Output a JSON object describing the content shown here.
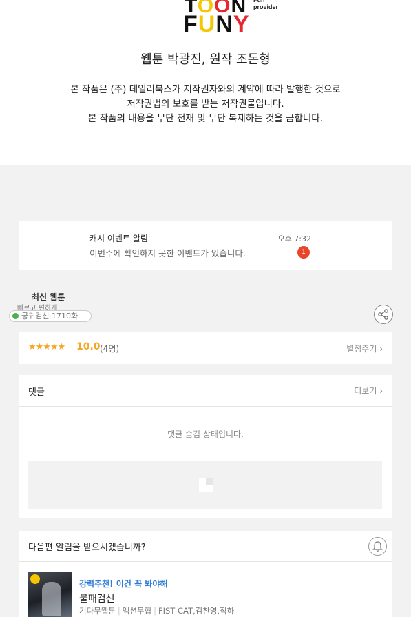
{
  "logo": {
    "line1_a": "T",
    "line1_b": "O",
    "line1_c": "O",
    "line1_d": "N",
    "tagline": "Fun provider",
    "line2_a": "F",
    "line2_b": "U",
    "line2_c": "N",
    "line2_d": "Y"
  },
  "credit": "웹툰 박광진, 원작 조돈형",
  "notice": [
    "본 작품은 (주) 데일리북스가 저작권자와의 계약에 따라 발행한 것으로",
    "저작권법의 보호를 받는 저작권물입니다.",
    "본 작품의 내용을 무단 전재 및 무단 복제하는 것을 금합니다."
  ],
  "push": {
    "title": "캐시 이벤트 알림",
    "time": "오후 7:32",
    "body": "이번주에 확인하지 못한 이벤트가 있습니다.",
    "badge": "1"
  },
  "latest": {
    "title": "최신 웹툰",
    "subtitle": "빠르고 편하게",
    "search": "궁귀검신 1710화"
  },
  "rating": {
    "stars": "★★★★★",
    "score": "10.0",
    "count": "(4명)",
    "rate_label": "별점주기 ›"
  },
  "comments": {
    "title": "댓글",
    "more": "더보기 ›",
    "hidden_message": "댓글 숨김 상태입니다."
  },
  "next": {
    "title": "다음편 알림을 받으시겠습니까?",
    "rec_tag": "강력추천! 이건 꼭 봐야해",
    "rec_title": "불패검선",
    "rec_platform": "기다무웹툰",
    "rec_genre": "액션무협",
    "rec_authors": "FIST CAT,김찬영,적하"
  },
  "colors": {
    "accent_orange": "#f5a623",
    "badge_red": "#e9452a",
    "link_blue": "#2f7cd8"
  }
}
